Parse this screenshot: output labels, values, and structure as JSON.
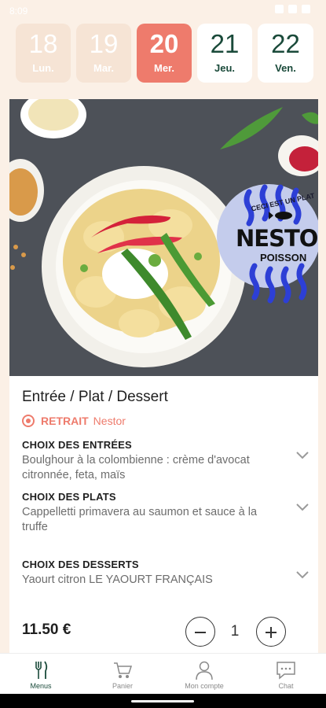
{
  "status_bar": {
    "time": "8:09"
  },
  "days": [
    {
      "num": "18",
      "label": "Lun.",
      "state": "past"
    },
    {
      "num": "19",
      "label": "Mar.",
      "state": "past"
    },
    {
      "num": "20",
      "label": "Mer.",
      "state": "active"
    },
    {
      "num": "21",
      "label": "Jeu.",
      "state": "future"
    },
    {
      "num": "22",
      "label": "Ven.",
      "state": "future"
    }
  ],
  "card": {
    "badge": {
      "small": "CECI EST UN PLAT",
      "big": "NESTO",
      "category": "POISSON",
      "icon": "fish-icon"
    },
    "title": "Entrée / Plat / Dessert",
    "pickup": {
      "label": "RETRAIT",
      "place": "Nestor",
      "icon": "location-pin-icon"
    },
    "choices": [
      {
        "heading": "CHOIX DES ENTRÉES",
        "value": "Boulghour à la colombienne : crème d'avocat citronnée, feta, maïs"
      },
      {
        "heading": "CHOIX DES PLATS",
        "value": " Cappelletti primavera au saumon et sauce à la truffe"
      },
      {
        "heading": "CHOIX DES DESSERTS",
        "value": "Yaourt citron LE YAOURT FRANÇAIS"
      }
    ],
    "price": "11.50 €",
    "quantity": "1"
  },
  "nav": [
    {
      "label": "Menus",
      "icon": "fork-knife-icon",
      "active": true
    },
    {
      "label": "Panier",
      "icon": "cart-icon",
      "active": false
    },
    {
      "label": "Mon compte",
      "icon": "user-icon",
      "active": false
    },
    {
      "label": "Chat",
      "icon": "chat-icon",
      "active": false
    }
  ],
  "colors": {
    "accent": "#ee7b6c",
    "brand_green": "#1a4a3a",
    "background": "#fbf0e6",
    "badge_blue": "#2d3fd6",
    "badge_bg": "#c4ccec"
  }
}
